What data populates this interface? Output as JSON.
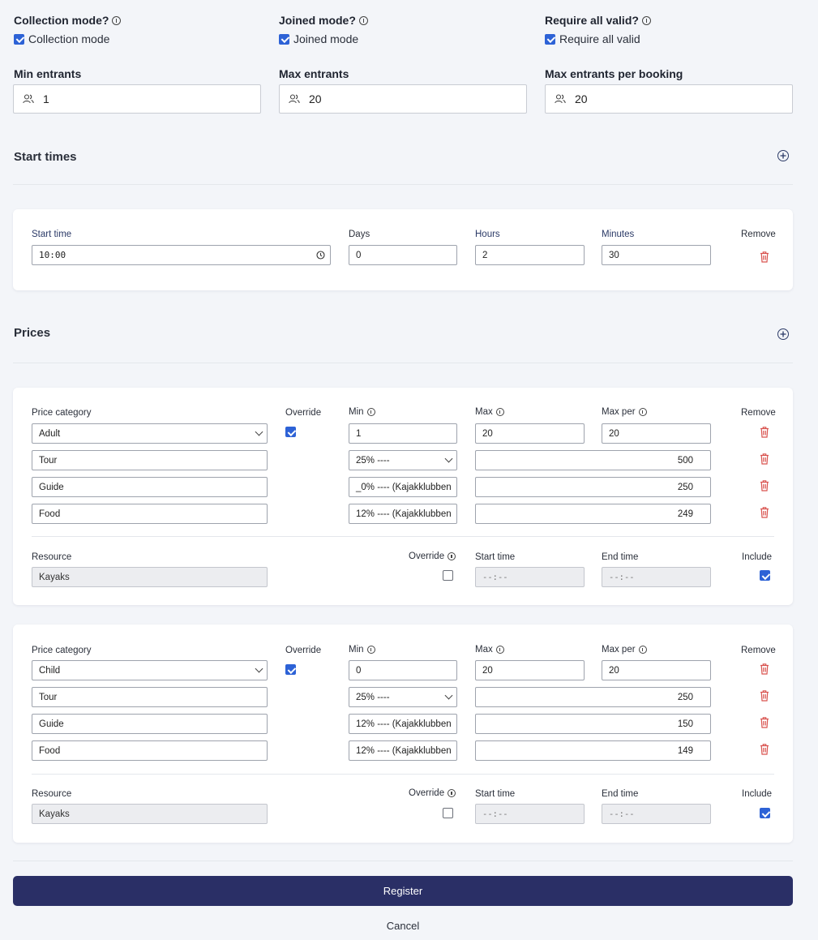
{
  "flags": [
    {
      "label": "Collection mode?",
      "checkbox_label": "Collection mode",
      "checked": true
    },
    {
      "label": "Joined mode?",
      "checkbox_label": "Joined mode",
      "checked": true
    },
    {
      "label": "Require all valid?",
      "checkbox_label": "Require all valid",
      "checked": true
    }
  ],
  "entrants": [
    {
      "label": "Min entrants",
      "value": "1"
    },
    {
      "label": "Max entrants",
      "value": "20"
    },
    {
      "label": "Max entrants per booking",
      "value": "20"
    }
  ],
  "start_times": {
    "title": "Start times",
    "headers": {
      "start_time": "Start time",
      "days": "Days",
      "hours": "Hours",
      "minutes": "Minutes",
      "remove": "Remove"
    },
    "row": {
      "start_time": "10:00",
      "days": "0",
      "hours": "2",
      "minutes": "30"
    }
  },
  "prices": {
    "title": "Prices",
    "headers": {
      "category": "Price category",
      "override": "Override",
      "min": "Min",
      "max": "Max",
      "max_per": "Max per",
      "remove": "Remove"
    },
    "resource_headers": {
      "resource": "Resource",
      "override": "Override",
      "start_time": "Start time",
      "end_time": "End time",
      "include": "Include"
    },
    "cards": [
      {
        "category": "Adult",
        "override": true,
        "min": "1",
        "max": "20",
        "max_per": "20",
        "lines": [
          {
            "name": "Tour",
            "vat": "25% ----",
            "vat_is_select": true,
            "amount": "500"
          },
          {
            "name": "Guide",
            "vat": "_0% ---- (Kajakklubben",
            "vat_is_select": false,
            "amount": "250"
          },
          {
            "name": "Food",
            "vat": "12% ---- (Kajakklubben",
            "vat_is_select": false,
            "amount": "249"
          }
        ],
        "resource": {
          "name": "Kayaks",
          "override": false,
          "start_time": "--:--",
          "end_time": "--:--",
          "include": true
        }
      },
      {
        "category": "Child",
        "override": true,
        "min": "0",
        "max": "20",
        "max_per": "20",
        "lines": [
          {
            "name": "Tour",
            "vat": "25% ----",
            "vat_is_select": true,
            "amount": "250"
          },
          {
            "name": "Guide",
            "vat": "12% ---- (Kajakklubben",
            "vat_is_select": false,
            "amount": "150"
          },
          {
            "name": "Food",
            "vat": "12% ---- (Kajakklubben",
            "vat_is_select": false,
            "amount": "149"
          }
        ],
        "resource": {
          "name": "Kayaks",
          "override": false,
          "start_time": "--:--",
          "end_time": "--:--",
          "include": true
        }
      }
    ]
  },
  "actions": {
    "register": "Register",
    "cancel": "Cancel"
  },
  "colors": {
    "accent": "#2d62d6",
    "primary_button": "#2a2f66",
    "danger": "#d9534f",
    "background": "#f3f5f9"
  }
}
